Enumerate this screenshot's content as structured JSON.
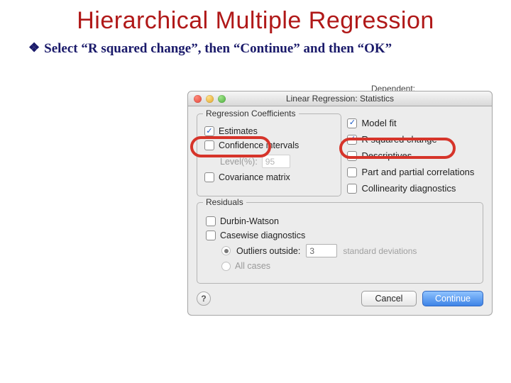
{
  "slide": {
    "title": "Hierarchical Multiple Regression",
    "bullet_glyph": "❖",
    "instruction": "Select “R squared change”, then “Continue” and then “OK”"
  },
  "peek": {
    "dependent_label": "Dependent:"
  },
  "dialog": {
    "title": "Linear Regression: Statistics",
    "coeff_group": "Regression Coefficients",
    "left": {
      "estimates": "Estimates",
      "conf_int": "Confidence intervals",
      "level_label": "Level(%):",
      "level_value": "95",
      "cov_matrix": "Covariance matrix"
    },
    "right": {
      "model_fit": "Model fit",
      "r_sq_change": "R squared change",
      "descriptives": "Descriptives",
      "part_partial": "Part and partial correlations",
      "collinearity": "Collinearity diagnostics"
    },
    "residuals": {
      "group": "Residuals",
      "durbin": "Durbin-Watson",
      "casewise": "Casewise diagnostics",
      "outliers_label": "Outliers outside:",
      "outliers_value": "3",
      "std_dev": "standard deviations",
      "all_cases": "All cases"
    },
    "buttons": {
      "help": "?",
      "cancel": "Cancel",
      "continue": "Continue"
    }
  }
}
